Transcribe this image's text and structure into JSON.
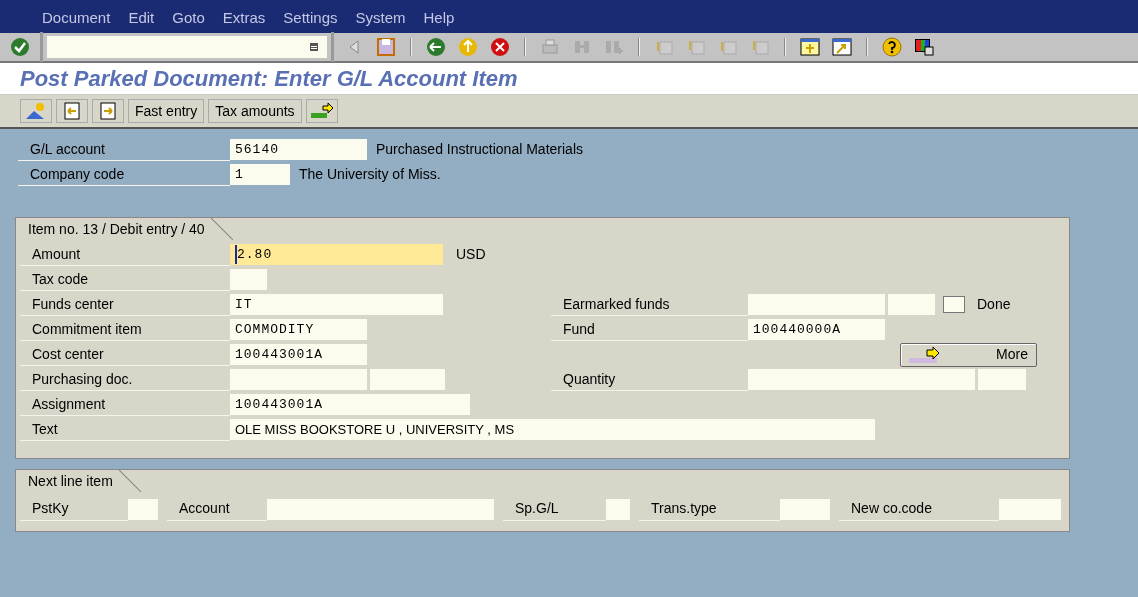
{
  "menu": [
    {
      "label": "Document"
    },
    {
      "label": "Edit"
    },
    {
      "label": "Goto"
    },
    {
      "label": "Extras"
    },
    {
      "label": "Settings"
    },
    {
      "label": "System"
    },
    {
      "label": "Help"
    }
  ],
  "title": "Post Parked Document: Enter G/L Account Item",
  "app_toolbar": [
    {
      "kind": "icon"
    },
    {
      "kind": "icon"
    },
    {
      "kind": "icon"
    },
    {
      "kind": "text",
      "label": "Fast entry"
    },
    {
      "kind": "text",
      "label": "Tax amounts"
    },
    {
      "kind": "icon"
    }
  ],
  "header_fields": [
    {
      "label": "G/L account",
      "value": "56140",
      "description": "Purchased Instructional Materials"
    },
    {
      "label": "Company code",
      "value": "1",
      "description": "The University of Miss."
    }
  ],
  "item": {
    "title": "Item no. 13 / Debit entry / 40",
    "rows": [
      {
        "label": "Amount",
        "fields": [
          {
            "value": "2.80",
            "focused": true
          }
        ],
        "unit": "USD"
      },
      {
        "label": "Tax code",
        "fields": [
          {
            "focused": false
          }
        ]
      },
      {
        "label": "Funds center",
        "fields": [
          {
            "value": "IT",
            "focused": false
          }
        ]
      },
      {
        "label": "Commitment item",
        "fields": [
          {
            "value": "COMMODITY",
            "focused": false
          }
        ]
      },
      {
        "label": "Cost center",
        "fields": [
          {
            "value": "100443001A",
            "focused": false
          }
        ]
      },
      {
        "label": "Purchasing doc.",
        "fields": [
          {
            "focused": false
          },
          {
            "focused": false
          }
        ]
      },
      {
        "label": "Assignment",
        "fields": [
          {
            "value": "100443001A",
            "focused": false
          }
        ]
      },
      {
        "label": "Text",
        "fields": [
          {
            "value": "OLE MISS BOOKSTORE U , UNIVERSITY , MS",
            "focused": false
          }
        ]
      }
    ],
    "right_rows": [
      {
        "kind": "field",
        "label": "Earmarked funds",
        "fields": [
          {
            "focused": false
          },
          {
            "focused": false
          }
        ],
        "checkbox": {
          "label": "Done",
          "checked": false
        }
      },
      {
        "kind": "field",
        "label": "Fund",
        "fields": [
          {
            "value": "100440000A"
          }
        ]
      },
      {
        "kind": "button",
        "label": "More"
      },
      {
        "kind": "field",
        "label": "Quantity",
        "fields": [
          {
            "focused": false
          },
          {
            "focused": false
          }
        ]
      }
    ]
  },
  "next_line_item": {
    "title": "Next line item",
    "fields": [
      {
        "label": "PstKy"
      },
      {
        "label": "Account"
      },
      {
        "label": "Sp.G/L"
      },
      {
        "label": "Trans.type"
      },
      {
        "label": "New co.code"
      }
    ]
  }
}
